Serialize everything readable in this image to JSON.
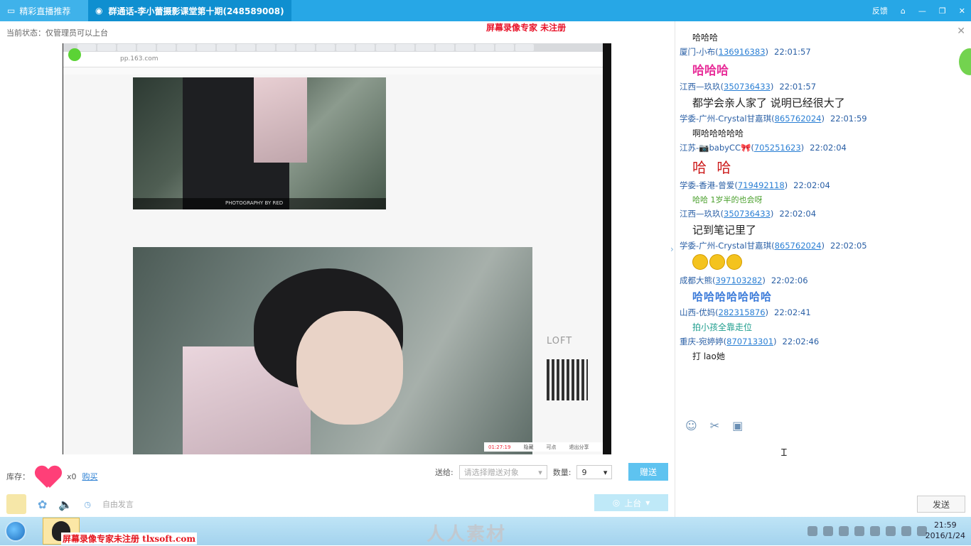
{
  "title_bar": {
    "tab_recommend": "精彩直播推荐",
    "tab_group": "群通话-李小蕾摄影课堂第十期(248589008)",
    "feedback": "反馈"
  },
  "watermark_top": "屏幕录像专家  未注册",
  "status_text": "当前状态：仅管理员可以上台",
  "video": {
    "address": "pp.163.com",
    "photo_caption": "PHOTOGRAPHY BY RED",
    "brand": "LOFT",
    "bottom_bar": [
      "01:27:19",
      "隐藏",
      "可点",
      "退出分享"
    ]
  },
  "gift_bar": {
    "inventory_label": "库存：",
    "count": "x0",
    "buy_label": "购买",
    "send_to_label": "送给:",
    "send_to_placeholder": "请选择赠送对象",
    "quantity_label": "数量:",
    "quantity_value": "9",
    "give_button": "赠送"
  },
  "toolbar": {
    "free_speak": "自由发言",
    "go_stage": "上台"
  },
  "chat": {
    "messages": [
      {
        "name": "",
        "qq": "",
        "time": "",
        "text": "哈哈哈",
        "style": "plain"
      },
      {
        "name": "厦门-小布",
        "qq": "136916383",
        "time": "22:01:57",
        "text": "哈哈哈",
        "style": "pink"
      },
      {
        "name": "江西—玖玖",
        "qq": "350736433",
        "time": "22:01:57",
        "text": "都学会亲人家了 说明已经很大了",
        "style": "big"
      },
      {
        "name": "学委-广州-Crystal甘嘉琪",
        "qq": "865762024",
        "time": "22:01:59",
        "text": "啊哈哈哈哈哈",
        "style": "plain"
      },
      {
        "name": "江苏-📷babyCC🎀",
        "qq": "705251623",
        "time": "22:02:04",
        "text": "哈 哈",
        "style": "red"
      },
      {
        "name": "学委-香港-曾爱",
        "qq": "719492118",
        "time": "22:02:04",
        "text": "哈哈 1岁半的也会呀",
        "style": "green"
      },
      {
        "name": "江西—玖玖",
        "qq": "350736433",
        "time": "22:02:04",
        "text": "记到笔记里了",
        "style": "big"
      },
      {
        "name": "学委-广州-Crystal甘嘉琪",
        "qq": "865762024",
        "time": "22:02:05",
        "text": "",
        "style": "emoji"
      },
      {
        "name": "成都大熊",
        "qq": "397103282",
        "time": "22:02:06",
        "text": "哈哈哈哈哈哈哈",
        "style": "blue"
      },
      {
        "name": "山西-优妈",
        "qq": "282315876",
        "time": "22:02:41",
        "text": "拍小孩全靠走位",
        "style": "teal"
      },
      {
        "name": "重庆-宛婷婷",
        "qq": "870713301",
        "time": "22:02:46",
        "text": "打 lao她",
        "style": "plain"
      }
    ],
    "send_button": "发送"
  },
  "taskbar": {
    "watermark": "屏幕录像专家未注册 tlxsoft.com",
    "center_logo": "人人素材",
    "time": "21:59",
    "date": "2016/1/24"
  },
  "colors": {
    "title_bar": "#27a7e6",
    "accent_blue": "#2a5fa5",
    "give_button": "#5ec3f0"
  }
}
